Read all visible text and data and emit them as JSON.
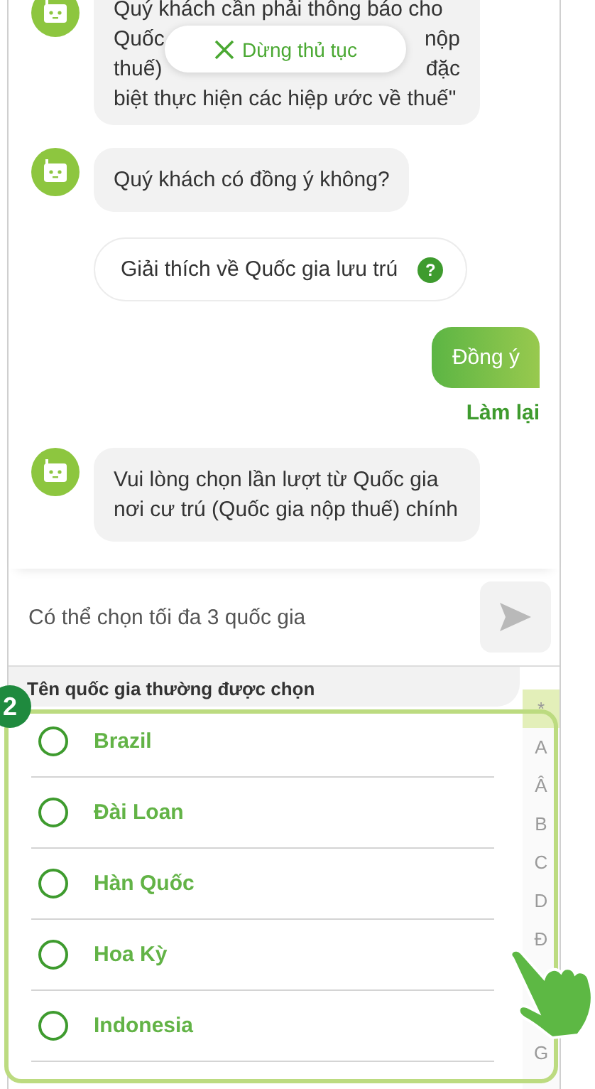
{
  "chat": [
    {
      "kind": "bot_partial",
      "lines": [
        [
          "Quý khách cần phải thông báo cho"
        ],
        [
          "Quốc",
          "nộp"
        ],
        [
          "thuế)",
          "đặc"
        ],
        [
          "biệt thực hiện các hiệp ước về thuế\""
        ]
      ]
    },
    {
      "kind": "bot",
      "text": "Quý khách có đồng ý không?"
    },
    {
      "kind": "chip",
      "text": "Giải thích về Quốc gia lưu trú",
      "icon": "?"
    },
    {
      "kind": "user",
      "text": "Đồng ý"
    },
    {
      "kind": "link",
      "text": "Làm lại"
    },
    {
      "kind": "bot",
      "text": "Vui lòng chọn lần lượt từ Quốc gia nơi cư trú (Quốc gia nộp thuế) chính"
    }
  ],
  "stop_button": {
    "label": "Dừng thủ tục"
  },
  "input": {
    "placeholder": "Có thể chọn tối đa 3 quốc gia"
  },
  "country_list": {
    "header": "Tên quốc gia thường được chọn",
    "items": [
      {
        "name": "Brazil",
        "selected": false
      },
      {
        "name": "Đài Loan",
        "selected": false
      },
      {
        "name": "Hàn Quốc",
        "selected": false
      },
      {
        "name": "Hoa Kỳ",
        "selected": false
      },
      {
        "name": "Indonesia",
        "selected": false
      }
    ],
    "index": [
      {
        "label": "*",
        "selected": true
      },
      {
        "label": "A",
        "selected": false
      },
      {
        "label": "Â",
        "selected": false
      },
      {
        "label": "B",
        "selected": false
      },
      {
        "label": "C",
        "selected": false
      },
      {
        "label": "D",
        "selected": false
      },
      {
        "label": "Đ",
        "selected": false
      },
      {
        "label": "G",
        "selected": false,
        "gap_before": true
      }
    ]
  },
  "tutorial": {
    "step": "2"
  }
}
